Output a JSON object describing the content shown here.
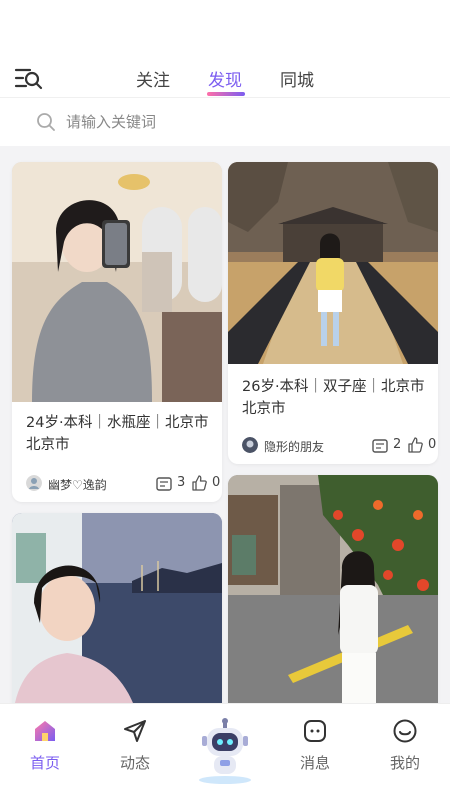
{
  "header": {
    "tabs": [
      {
        "label": "关注",
        "active": false
      },
      {
        "label": "发现",
        "active": true
      },
      {
        "label": "同城",
        "active": false
      }
    ],
    "filter_icon": "filter-list-icon",
    "accent_color": "#7b5df0"
  },
  "search": {
    "placeholder": "请输入关键词",
    "icon": "search-icon"
  },
  "feed": {
    "cards": [
      {
        "caption": "24岁·本科｜水瓶座｜北京市 北京市",
        "username": "幽梦♡逸韵",
        "comments": "3",
        "likes": "0"
      },
      {
        "caption": "26岁·本科｜双子座｜北京市 北京市",
        "username": "隐形的朋友",
        "comments": "2",
        "likes": "0"
      },
      {
        "caption": "",
        "username": "",
        "comments": "",
        "likes": ""
      },
      {
        "caption": "",
        "username": "",
        "comments": "",
        "likes": ""
      }
    ]
  },
  "bottom_nav": {
    "items": [
      {
        "label": "首页",
        "icon": "home-icon",
        "active": true
      },
      {
        "label": "动态",
        "icon": "send-icon",
        "active": false
      },
      {
        "label": "",
        "icon": "robot-icon",
        "active": false
      },
      {
        "label": "消息",
        "icon": "message-icon",
        "active": false
      },
      {
        "label": "我的",
        "icon": "profile-icon",
        "active": false
      }
    ]
  }
}
